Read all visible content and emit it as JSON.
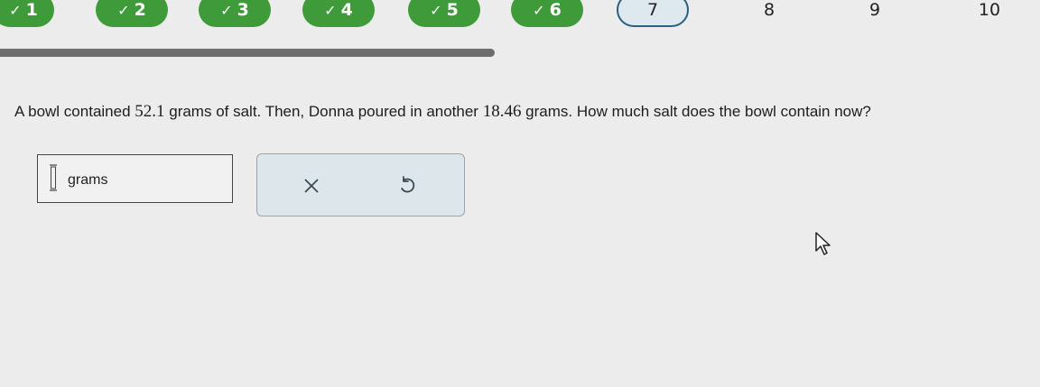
{
  "progress": {
    "steps": [
      {
        "label": "1",
        "status": "done"
      },
      {
        "label": "2",
        "status": "done"
      },
      {
        "label": "3",
        "status": "done"
      },
      {
        "label": "4",
        "status": "done"
      },
      {
        "label": "5",
        "status": "done"
      },
      {
        "label": "6",
        "status": "done"
      },
      {
        "label": "7",
        "status": "current"
      },
      {
        "label": "8",
        "status": "todo"
      },
      {
        "label": "9",
        "status": "todo"
      },
      {
        "label": "10",
        "status": "todo"
      }
    ],
    "completed_fraction": 0.475,
    "check_glyph": "✓",
    "done_color": "#3f9b3a",
    "current_border_color": "#2d5f7f"
  },
  "question": {
    "part1": "A bowl contained ",
    "amount1": "52.1",
    "part2": " grams of salt. Then, Donna poured in another ",
    "amount2": "18.46",
    "part3": " grams. How much salt does the bowl contain now?"
  },
  "answer": {
    "value": "",
    "unit": "grams"
  },
  "tools": {
    "clear_glyph": "×",
    "clear_icon": "close-icon",
    "undo_icon": "undo-icon"
  }
}
